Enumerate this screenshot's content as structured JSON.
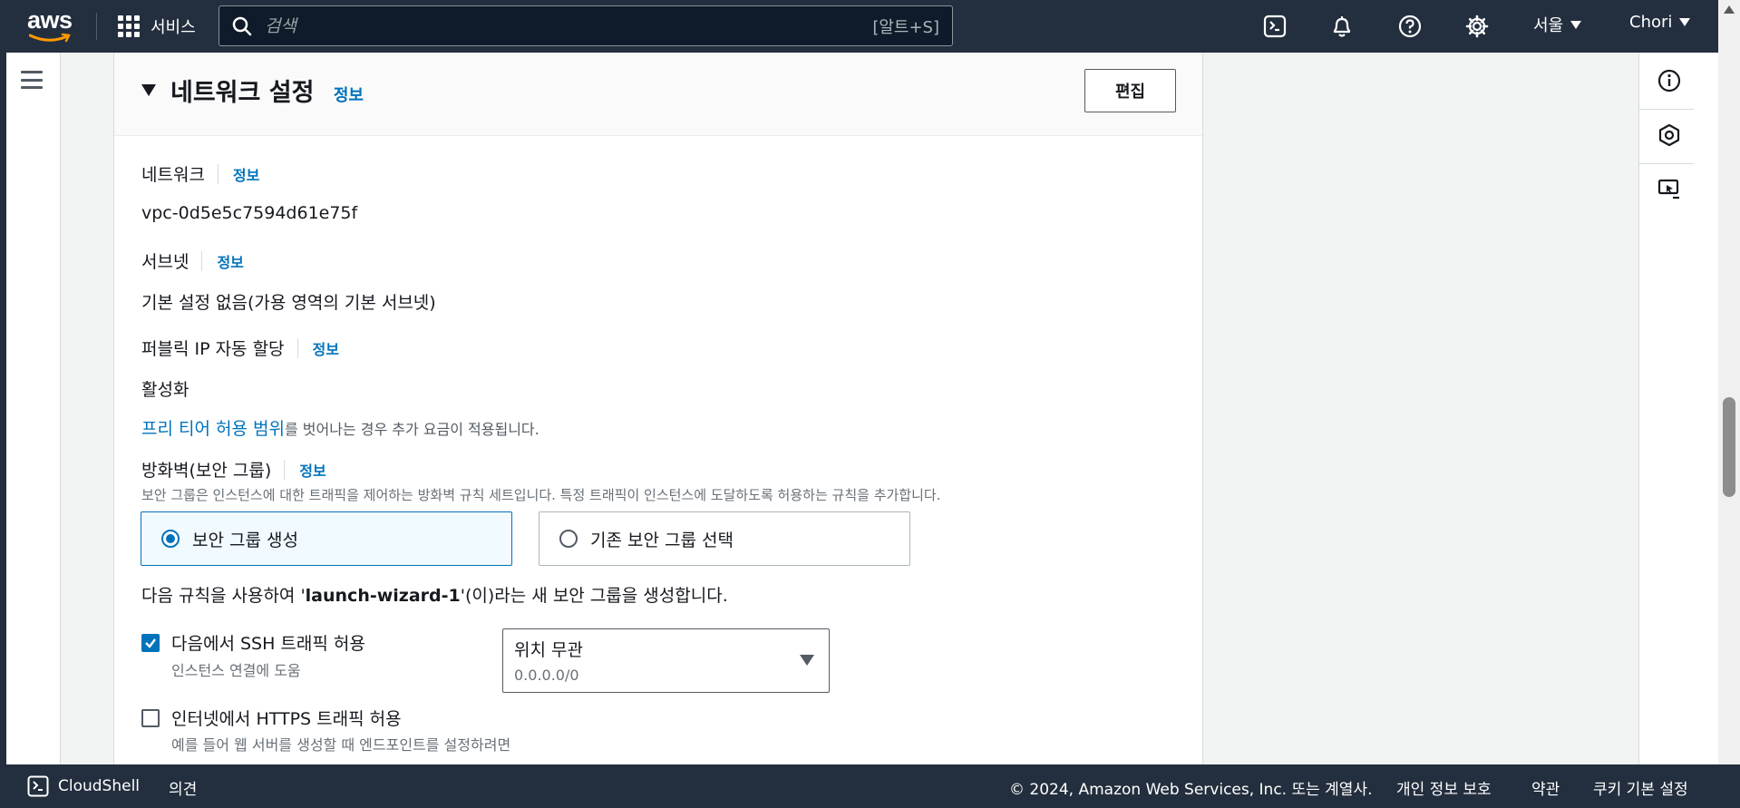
{
  "header": {
    "logo_text": "aws",
    "services_label": "서비스",
    "search_placeholder": "검색",
    "search_shortcut": "[알트+S]",
    "region_label": "서울",
    "user_label": "Chori",
    "icons": [
      "cloudshell-icon",
      "bell-icon",
      "help-icon",
      "settings-icon"
    ]
  },
  "section": {
    "title": "네트워크 설정",
    "info": "정보",
    "edit_button": "편집"
  },
  "fields": {
    "network": {
      "label": "네트워크",
      "info": "정보",
      "value": "vpc-0d5e5c7594d61e75f"
    },
    "subnet": {
      "label": "서브넷",
      "info": "정보",
      "value": "기본 설정 없음(가용 영역의 기본 서브넷)"
    },
    "public_ip": {
      "label": "퍼블릭 IP 자동 할당",
      "info": "정보",
      "value": "활성화"
    },
    "free_tier_link": "프리 티어 허용 범위",
    "free_tier_note": "를 벗어나는 경우 추가 요금이 적용됩니다.",
    "firewall": {
      "label": "방화벽(보안 그룹)",
      "info": "정보",
      "description": "보안 그룹은 인스턴스에 대한 트래픽을 제어하는 방화벽 규칙 세트입니다. 특정 트래픽이 인스턴스에 도달하도록 허용하는 규칙을 추가합니다."
    }
  },
  "security_group_options": {
    "create": "보안 그룹 생성",
    "existing": "기존 보안 그룹 선택",
    "selected": "create"
  },
  "rule_sentence": {
    "prefix": "다음 규칙을 사용하여 '",
    "group_name": "launch-wizard-1",
    "suffix": "'(이)라는 새 보안 그룹을 생성합니다."
  },
  "rules": {
    "ssh": {
      "label": "다음에서 SSH 트래픽 허용",
      "desc": "인스턴스 연결에 도움",
      "checked": true
    },
    "ssh_source": {
      "value": "위치 무관",
      "desc": "0.0.0.0/0"
    },
    "https": {
      "label": "인터넷에서 HTTPS 트래픽 허용",
      "desc": "예를 들어 웹 서버를 생성할 때 엔드포인트를 설정하려면",
      "checked": false
    }
  },
  "footer": {
    "cloudshell": "CloudShell",
    "feedback": "의견",
    "copyright": "© 2024, Amazon Web Services, Inc. 또는 계열사.",
    "privacy": "개인 정보 보호",
    "terms": "약관",
    "cookies": "쿠키 기본 설정"
  },
  "colors": {
    "nav_bg": "#232f3e",
    "link": "#0073bb",
    "selected_tile_bg": "#f1faff",
    "aws_smile": "#ff9900"
  }
}
